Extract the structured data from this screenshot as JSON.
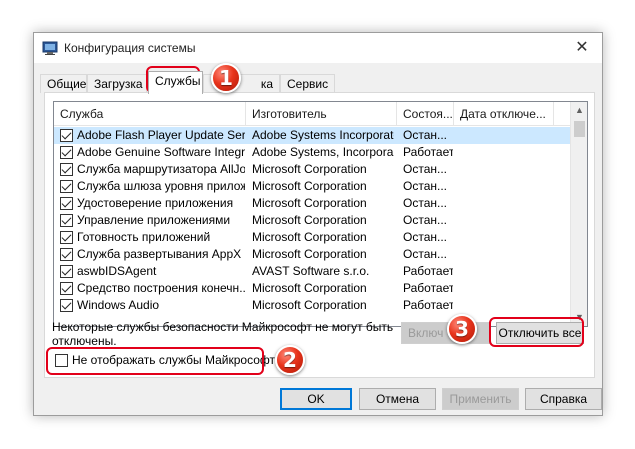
{
  "window": {
    "title": "Конфигурация системы",
    "close_glyph": "✕"
  },
  "tabs": [
    {
      "label": "Общие",
      "active": false
    },
    {
      "label": "Загрузка",
      "active": false
    },
    {
      "label": "Службы",
      "active": true
    },
    {
      "label": "ка",
      "active": false
    },
    {
      "label": "Сервис",
      "active": false
    }
  ],
  "services_table": {
    "columns": [
      "Служба",
      "Изготовитель",
      "Состоя...",
      "Дата отключе..."
    ],
    "rows": [
      {
        "name": "Adobe Flash Player Update Service",
        "vendor": "Adobe Systems Incorporated",
        "status": "Остан...",
        "date": "",
        "checked": true,
        "selected": true
      },
      {
        "name": "Adobe Genuine Software Integri...",
        "vendor": "Adobe Systems, Incorpora...",
        "status": "Работает",
        "date": "",
        "checked": true,
        "selected": false
      },
      {
        "name": "Служба маршрутизатора AllJoyn",
        "vendor": "Microsoft Corporation",
        "status": "Остан...",
        "date": "",
        "checked": true,
        "selected": false
      },
      {
        "name": "Служба шлюза уровня прилож...",
        "vendor": "Microsoft Corporation",
        "status": "Остан...",
        "date": "",
        "checked": true,
        "selected": false
      },
      {
        "name": "Удостоверение приложения",
        "vendor": "Microsoft Corporation",
        "status": "Остан...",
        "date": "",
        "checked": true,
        "selected": false
      },
      {
        "name": "Управление приложениями",
        "vendor": "Microsoft Corporation",
        "status": "Остан...",
        "date": "",
        "checked": true,
        "selected": false
      },
      {
        "name": "Готовность приложений",
        "vendor": "Microsoft Corporation",
        "status": "Остан...",
        "date": "",
        "checked": true,
        "selected": false
      },
      {
        "name": "Служба развертывания AppX (...",
        "vendor": "Microsoft Corporation",
        "status": "Остан...",
        "date": "",
        "checked": true,
        "selected": false
      },
      {
        "name": "aswbIDSAgent",
        "vendor": "AVAST Software s.r.o.",
        "status": "Работает",
        "date": "",
        "checked": true,
        "selected": false
      },
      {
        "name": "Средство построения конечн...",
        "vendor": "Microsoft Corporation",
        "status": "Работает",
        "date": "",
        "checked": true,
        "selected": false
      },
      {
        "name": "Windows Audio",
        "vendor": "Microsoft Corporation",
        "status": "Работает",
        "date": "",
        "checked": true,
        "selected": false
      }
    ]
  },
  "note": "Некоторые службы безопасности Майкрософт не могут быть отключены.",
  "enable_all_label": "Включ",
  "disable_all_label": "Отключить все",
  "hide_ms_label": "Не отображать службы Майкрософт",
  "hide_ms_checked": false,
  "footer": {
    "ok": "OK",
    "cancel": "Отмена",
    "apply": "Применить",
    "help": "Справка"
  },
  "annotations": [
    "1",
    "2",
    "3"
  ],
  "colors": {
    "accent": "#0078d7",
    "highlight": "#e2001a",
    "selected_row": "#cce8ff"
  }
}
